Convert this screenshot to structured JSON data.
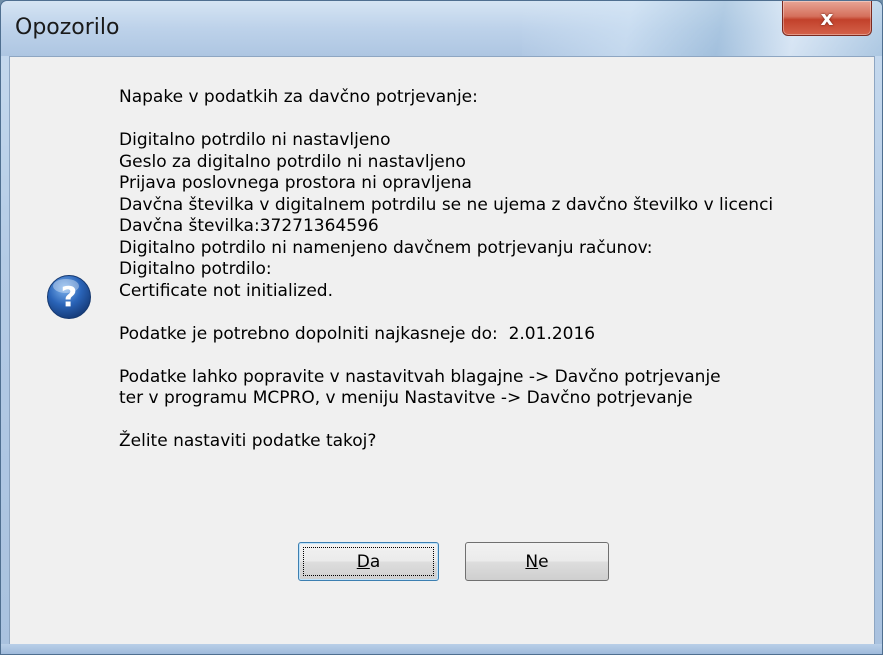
{
  "dialog": {
    "title": "Opozorilo",
    "close_symbol": "x",
    "icon": "question-icon",
    "lines": [
      "Napake v podatkih za davčno potrjevanje:",
      "",
      "Digitalno potrdilo ni nastavljeno",
      "Geslo za digitalno potrdilo ni nastavljeno",
      "Prijava poslovnega prostora ni opravljena",
      "Davčna številka v digitalnem potrdilu se ne ujema z davčno številko v licenci",
      "Davčna številka:37271364596",
      "Digitalno potrdilo ni namenjeno davčnem potrjevanju računov:",
      "Digitalno potrdilo:",
      "Certificate not initialized.",
      "",
      "Podatke je potrebno dopolniti najkasneje do:  2.01.2016",
      "",
      "Podatke lahko popravite v nastavitvah blagajne -> Davčno potrjevanje",
      "ter v programu MCPRO, v meniju Nastavitve -> Davčno potrjevanje",
      "",
      "Želite nastaviti podatke takoj?"
    ],
    "buttons": {
      "yes": {
        "access_key": "D",
        "rest": "a"
      },
      "no": {
        "access_key": "N",
        "rest": "e"
      }
    }
  },
  "colors": {
    "titlebar": "#bdd2ea",
    "close_button": "#c2412b",
    "client_bg": "#f0f0f0",
    "icon_blue": "#2a64b8"
  }
}
